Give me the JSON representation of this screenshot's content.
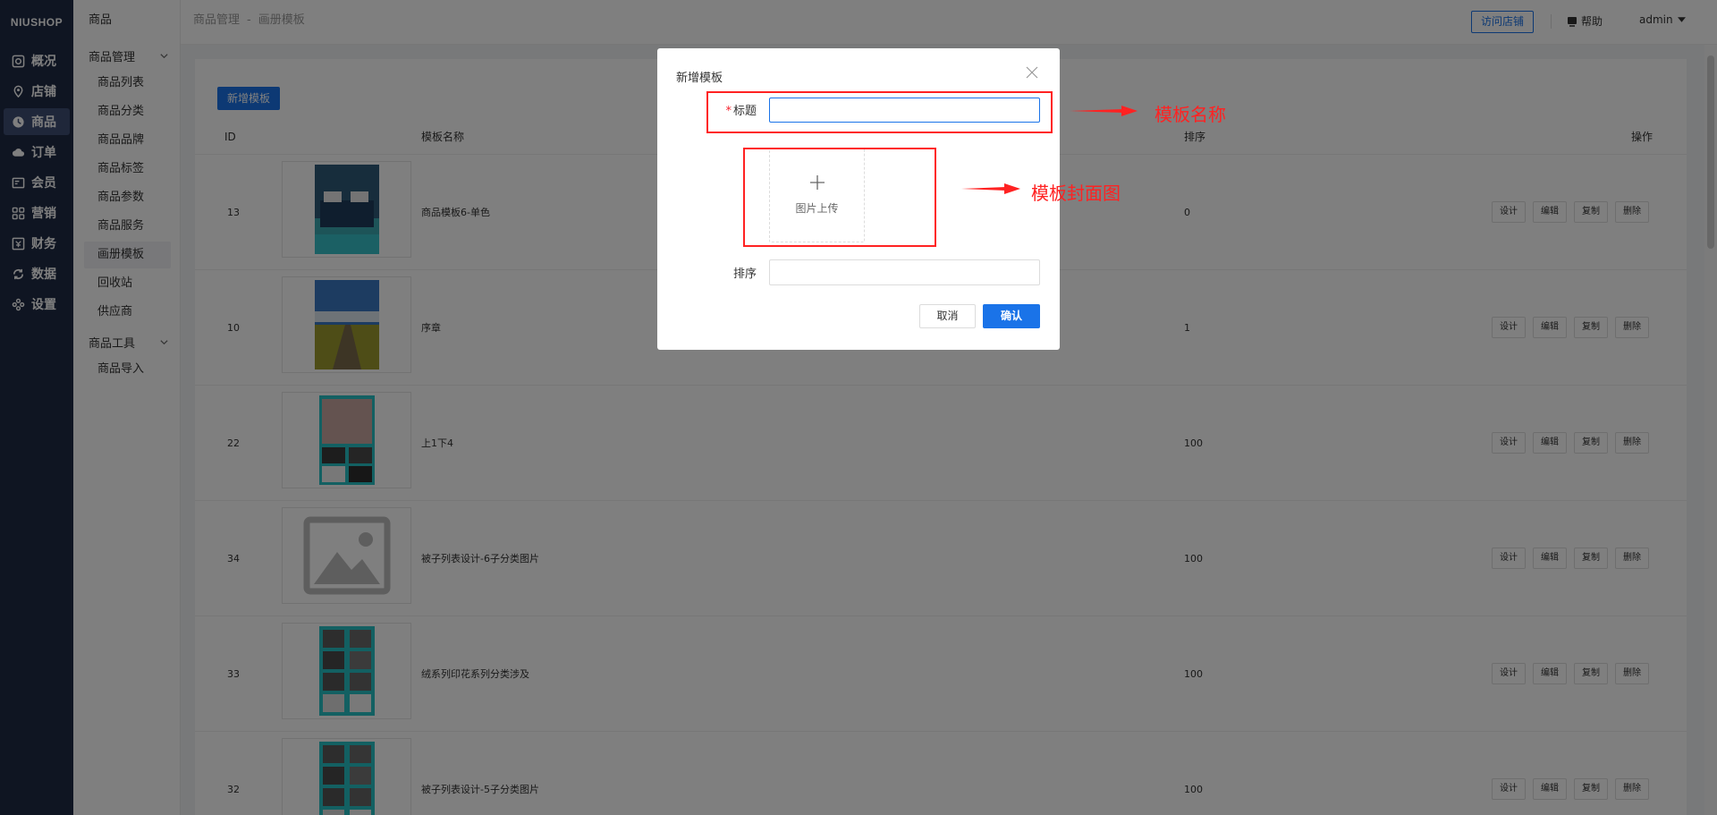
{
  "brand": {
    "logo_text": "NIUSHOP"
  },
  "primary_nav": [
    {
      "label": "概况",
      "icon": "dashboard-icon"
    },
    {
      "label": "店铺",
      "icon": "location-pin-icon"
    },
    {
      "label": "商品",
      "icon": "product-icon",
      "active": true
    },
    {
      "label": "订单",
      "icon": "cloud-order-icon"
    },
    {
      "label": "会员",
      "icon": "member-card-icon"
    },
    {
      "label": "营销",
      "icon": "grid-apps-icon"
    },
    {
      "label": "财务",
      "icon": "finance-icon"
    },
    {
      "label": "数据",
      "icon": "refresh-data-icon"
    },
    {
      "label": "设置",
      "icon": "settings-icon"
    }
  ],
  "secondary_nav": {
    "title": "商品",
    "groups": [
      {
        "label": "商品管理",
        "items": [
          "商品列表",
          "商品分类",
          "商品品牌",
          "商品标签",
          "商品参数",
          "商品服务",
          "画册模板",
          "回收站",
          "供应商"
        ],
        "active_item": "画册模板"
      },
      {
        "label": "商品工具",
        "items": [
          "商品导入"
        ]
      }
    ]
  },
  "header": {
    "breadcrumb": [
      "商品管理",
      "画册模板"
    ],
    "breadcrumb_sep": "-",
    "visit_store": "访问店铺",
    "help": "帮助",
    "user": "admin"
  },
  "toolbar": {
    "add_template": "新增模板"
  },
  "table": {
    "columns": {
      "id": "ID",
      "name": "模板名称",
      "sort": "排序",
      "actions": "操作"
    },
    "row_actions": [
      "设计",
      "编辑",
      "复制",
      "删除"
    ],
    "rows": [
      {
        "id": "13",
        "name": "商品模板6-单色",
        "sort": "0",
        "thumb": "bedroom-cover"
      },
      {
        "id": "10",
        "name": "序章",
        "sort": "1",
        "thumb": "landscape-cover"
      },
      {
        "id": "22",
        "name": "上1下4",
        "sort": "100",
        "thumb": "teal-collage-cover"
      },
      {
        "id": "34",
        "name": "被子列表设计-6子分类图片",
        "sort": "100",
        "thumb": "placeholder-image"
      },
      {
        "id": "33",
        "name": "绒系列印花系列分类涉及",
        "sort": "100",
        "thumb": "teal-grid-cover"
      },
      {
        "id": "32",
        "name": "被子列表设计-5子分类图片",
        "sort": "100",
        "thumb": "teal-grid-cover"
      }
    ]
  },
  "modal": {
    "title": "新增模板",
    "title_field_required_mark": "*",
    "title_field_label": "标题",
    "title_field_value": "",
    "upload_label": "图片上传",
    "sort_field_label": "排序",
    "sort_field_value": "",
    "cancel": "取消",
    "confirm": "确认"
  },
  "annotations": {
    "title_note": "模板名称",
    "cover_note": "模板封面图",
    "color": "#ff2222"
  },
  "colors": {
    "sidebar": "#1f2a44",
    "primary": "#1a73e8"
  }
}
